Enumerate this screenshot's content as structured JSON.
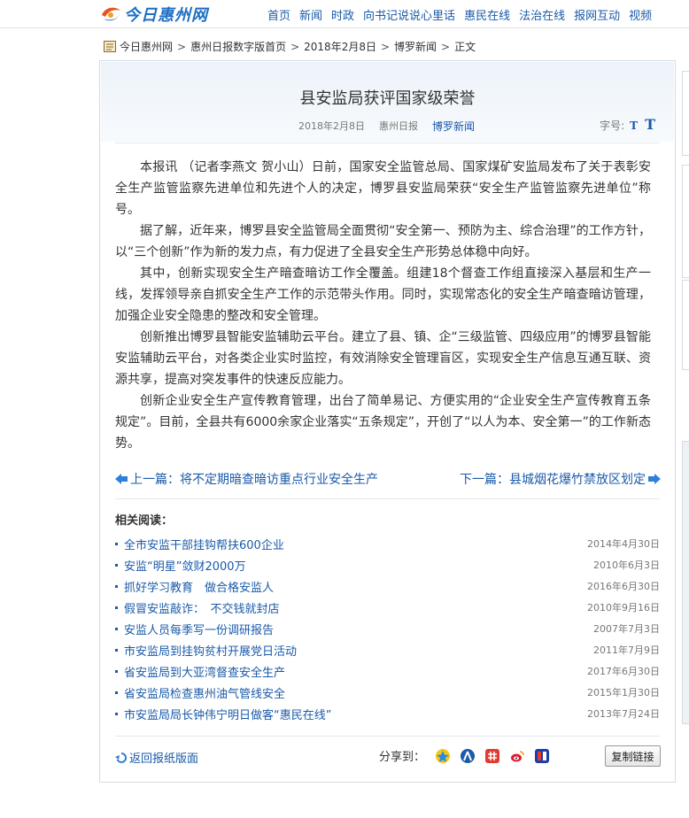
{
  "site": {
    "logo_text": "今日惠州网",
    "nav": [
      "首页",
      "新闻",
      "时政",
      "向书记说说心里话",
      "惠民在线",
      "法治在线",
      "报网互动",
      "视频"
    ]
  },
  "breadcrumb": [
    "今日惠州网",
    "惠州日报数字版首页",
    "2018年2月8日",
    "博罗新闻",
    "正文"
  ],
  "article": {
    "title": "县安监局获评国家级荣誉",
    "date": "2018年2月8日",
    "source": "惠州日报",
    "column": "博罗新闻",
    "font_size_label": "字号:",
    "font_small": "T",
    "font_large": "T",
    "paragraphs": [
      "本报讯 （记者李燕文 贺小山）日前，国家安全监管总局、国家煤矿安监局发布了关于表彰安全生产监管监察先进单位和先进个人的决定，博罗县安监局荣获“安全生产监管监察先进单位”称号。",
      "据了解，近年来，博罗县安全监管局全面贯彻“安全第一、预防为主、综合治理”的工作方针，以“三个创新”作为新的发力点，有力促进了全县安全生产形势总体稳中向好。",
      "其中，创新实现安全生产暗查暗访工作全覆盖。组建18个督查工作组直接深入基层和生产一线，发挥领导亲自抓安全生产工作的示范带头作用。同时，实现常态化的安全生产暗查暗访管理，加强企业安全隐患的整改和安全管理。",
      "创新推出博罗县智能安监辅助云平台。建立了县、镇、企“三级监管、四级应用”的博罗县智能安监辅助云平台，对各类企业实时监控，有效消除安全管理盲区，实现安全生产信息互通互联、资源共享，提高对突发事件的快速反应能力。",
      "创新企业安全生产宣传教育管理，出台了简单易记、方便实用的“企业安全生产宣传教育五条规定”。目前，全县共有6000余家企业落实“五条规定”，开创了“以人为本、安全第一”的工作新态势。"
    ]
  },
  "pager": {
    "prev": "上一篇：将不定期暗查暗访重点行业安全生产",
    "next": "下一篇：县城烟花爆竹禁放区划定"
  },
  "related": {
    "heading": "相关阅读：",
    "items": [
      {
        "title": "全市安监干部挂钩帮扶600企业",
        "date": "2014年4月30日"
      },
      {
        "title": "安监“明星”敛财2000万",
        "date": "2010年6月3日"
      },
      {
        "title": "抓好学习教育　做合格安监人",
        "date": "2016年6月30日"
      },
      {
        "title": "假冒安监敲诈：　不交钱就封店",
        "date": "2010年9月16日"
      },
      {
        "title": "安监人员每季写一份调研报告",
        "date": "2007年7月3日"
      },
      {
        "title": "市安监局到挂钩贫村开展党日活动",
        "date": "2011年7月9日"
      },
      {
        "title": "省安监局到大亚湾督查安全生产",
        "date": "2017年6月30日"
      },
      {
        "title": "省安监局检查惠州油气管线安全",
        "date": "2015年1月30日"
      },
      {
        "title": "市安监局局长钟伟宁明日做客“惠民在线”",
        "date": "2013年7月24日"
      }
    ]
  },
  "footer": {
    "back": "返回报纸版面",
    "share_label": "分享到：",
    "share_icons": [
      "qzone-icon",
      "renren-icon",
      "kaixin-icon",
      "weibo-icon",
      "sohu-icon"
    ],
    "copy_button": "复制链接"
  },
  "colors": {
    "link": "#1a5aa8",
    "header_bg": "#edf3fa",
    "border": "#d5dbe3"
  }
}
